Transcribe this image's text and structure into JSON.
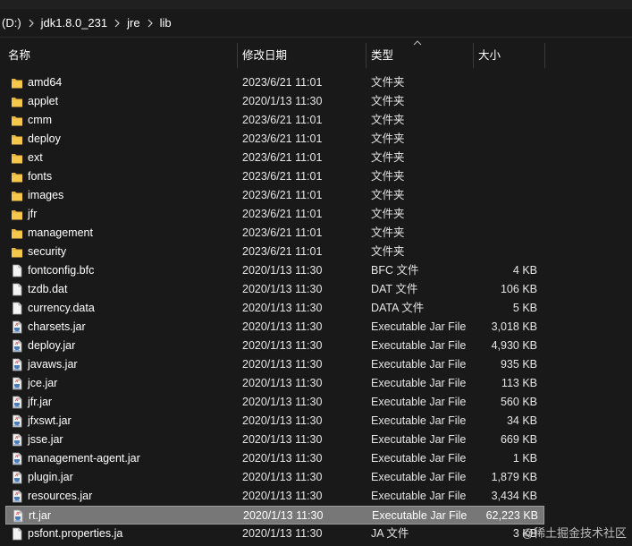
{
  "breadcrumb": [
    "(D:)",
    "jdk1.8.0_231",
    "jre",
    "lib"
  ],
  "columns": {
    "name": "名称",
    "date": "修改日期",
    "type": "类型",
    "size": "大小"
  },
  "files": [
    {
      "name": "amd64",
      "date": "2023/6/21 11:01",
      "type": "文件夹",
      "size": "",
      "kind": "folder"
    },
    {
      "name": "applet",
      "date": "2020/1/13 11:30",
      "type": "文件夹",
      "size": "",
      "kind": "folder"
    },
    {
      "name": "cmm",
      "date": "2023/6/21 11:01",
      "type": "文件夹",
      "size": "",
      "kind": "folder"
    },
    {
      "name": "deploy",
      "date": "2023/6/21 11:01",
      "type": "文件夹",
      "size": "",
      "kind": "folder"
    },
    {
      "name": "ext",
      "date": "2023/6/21 11:01",
      "type": "文件夹",
      "size": "",
      "kind": "folder"
    },
    {
      "name": "fonts",
      "date": "2023/6/21 11:01",
      "type": "文件夹",
      "size": "",
      "kind": "folder"
    },
    {
      "name": "images",
      "date": "2023/6/21 11:01",
      "type": "文件夹",
      "size": "",
      "kind": "folder"
    },
    {
      "name": "jfr",
      "date": "2023/6/21 11:01",
      "type": "文件夹",
      "size": "",
      "kind": "folder"
    },
    {
      "name": "management",
      "date": "2023/6/21 11:01",
      "type": "文件夹",
      "size": "",
      "kind": "folder"
    },
    {
      "name": "security",
      "date": "2023/6/21 11:01",
      "type": "文件夹",
      "size": "",
      "kind": "folder"
    },
    {
      "name": "fontconfig.bfc",
      "date": "2020/1/13 11:30",
      "type": "BFC 文件",
      "size": "4 KB",
      "kind": "file"
    },
    {
      "name": "tzdb.dat",
      "date": "2020/1/13 11:30",
      "type": "DAT 文件",
      "size": "106 KB",
      "kind": "file"
    },
    {
      "name": "currency.data",
      "date": "2020/1/13 11:30",
      "type": "DATA 文件",
      "size": "5 KB",
      "kind": "file"
    },
    {
      "name": "charsets.jar",
      "date": "2020/1/13 11:30",
      "type": "Executable Jar File",
      "size": "3,018 KB",
      "kind": "jar"
    },
    {
      "name": "deploy.jar",
      "date": "2020/1/13 11:30",
      "type": "Executable Jar File",
      "size": "4,930 KB",
      "kind": "jar"
    },
    {
      "name": "javaws.jar",
      "date": "2020/1/13 11:30",
      "type": "Executable Jar File",
      "size": "935 KB",
      "kind": "jar"
    },
    {
      "name": "jce.jar",
      "date": "2020/1/13 11:30",
      "type": "Executable Jar File",
      "size": "113 KB",
      "kind": "jar"
    },
    {
      "name": "jfr.jar",
      "date": "2020/1/13 11:30",
      "type": "Executable Jar File",
      "size": "560 KB",
      "kind": "jar"
    },
    {
      "name": "jfxswt.jar",
      "date": "2020/1/13 11:30",
      "type": "Executable Jar File",
      "size": "34 KB",
      "kind": "jar"
    },
    {
      "name": "jsse.jar",
      "date": "2020/1/13 11:30",
      "type": "Executable Jar File",
      "size": "669 KB",
      "kind": "jar"
    },
    {
      "name": "management-agent.jar",
      "date": "2020/1/13 11:30",
      "type": "Executable Jar File",
      "size": "1 KB",
      "kind": "jar"
    },
    {
      "name": "plugin.jar",
      "date": "2020/1/13 11:30",
      "type": "Executable Jar File",
      "size": "1,879 KB",
      "kind": "jar"
    },
    {
      "name": "resources.jar",
      "date": "2020/1/13 11:30",
      "type": "Executable Jar File",
      "size": "3,434 KB",
      "kind": "jar"
    },
    {
      "name": "rt.jar",
      "date": "2020/1/13 11:30",
      "type": "Executable Jar File",
      "size": "62,223 KB",
      "kind": "jar",
      "selected": true
    },
    {
      "name": "psfont.properties.ja",
      "date": "2020/1/13 11:30",
      "type": "JA 文件",
      "size": "3 KB",
      "kind": "file"
    }
  ],
  "watermark": "@稀土掘金技术社区",
  "colors": {
    "background": "#191919",
    "folder": "#f2c14e",
    "selection": "#777777"
  }
}
